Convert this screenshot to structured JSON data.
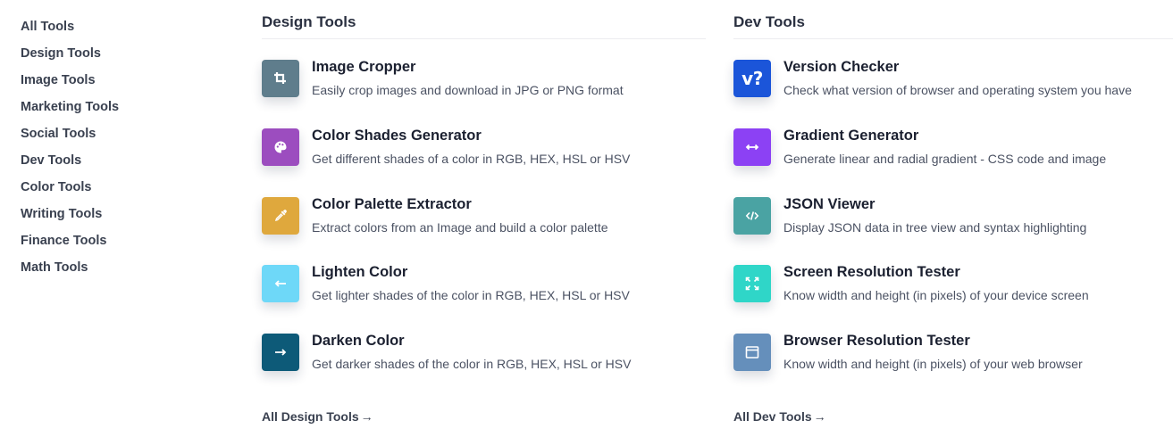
{
  "sidebar": {
    "items": [
      {
        "label": "All Tools"
      },
      {
        "label": "Design Tools"
      },
      {
        "label": "Image Tools"
      },
      {
        "label": "Marketing Tools"
      },
      {
        "label": "Social Tools"
      },
      {
        "label": "Dev Tools"
      },
      {
        "label": "Color Tools"
      },
      {
        "label": "Writing Tools"
      },
      {
        "label": "Finance Tools"
      },
      {
        "label": "Math Tools"
      }
    ]
  },
  "design": {
    "title": "Design Tools",
    "tools": [
      {
        "name": "Image Cropper",
        "desc": "Easily crop images and download in JPG or PNG format",
        "icon": "crop-icon",
        "color": "#5f7d8c"
      },
      {
        "name": "Color Shades Generator",
        "desc": "Get different shades of a color in RGB, HEX, HSL or HSV",
        "icon": "palette-icon",
        "color": "#9c4dbf"
      },
      {
        "name": "Color Palette Extractor",
        "desc": "Extract colors from an Image and build a color palette",
        "icon": "eyedropper-icon",
        "color": "#dfa83d"
      },
      {
        "name": "Lighten Color",
        "desc": "Get lighter shades of the color in RGB, HEX, HSL or HSV",
        "icon": "arrow-left-icon",
        "color": "#6ed8f8"
      },
      {
        "name": "Darken Color",
        "desc": "Get darker shades of the color in RGB, HEX, HSL or HSV",
        "icon": "arrow-right-icon",
        "color": "#0d5a78"
      }
    ],
    "all_link": "All Design Tools",
    "arrow": "→"
  },
  "dev": {
    "title": "Dev Tools",
    "tools": [
      {
        "name": "Version Checker",
        "desc": "Check what version of browser and operating system you have",
        "icon": "version-icon",
        "color": "#1b55d9",
        "icon_text": "v?"
      },
      {
        "name": "Gradient Generator",
        "desc": "Generate linear and radial gradient - CSS code and image",
        "icon": "double-arrow-icon",
        "color": "#8c41f4"
      },
      {
        "name": "JSON Viewer",
        "desc": "Display JSON data in tree view and syntax highlighting",
        "icon": "code-icon",
        "color": "#4aa3a3"
      },
      {
        "name": "Screen Resolution Tester",
        "desc": "Know width and height (in pixels) of your device screen",
        "icon": "expand-icon",
        "color": "#2fd6c8"
      },
      {
        "name": "Browser Resolution Tester",
        "desc": "Know width and height (in pixels) of your web browser",
        "icon": "browser-window-icon",
        "color": "#658fbb"
      }
    ],
    "all_link": "All Dev Tools",
    "arrow": "→"
  }
}
